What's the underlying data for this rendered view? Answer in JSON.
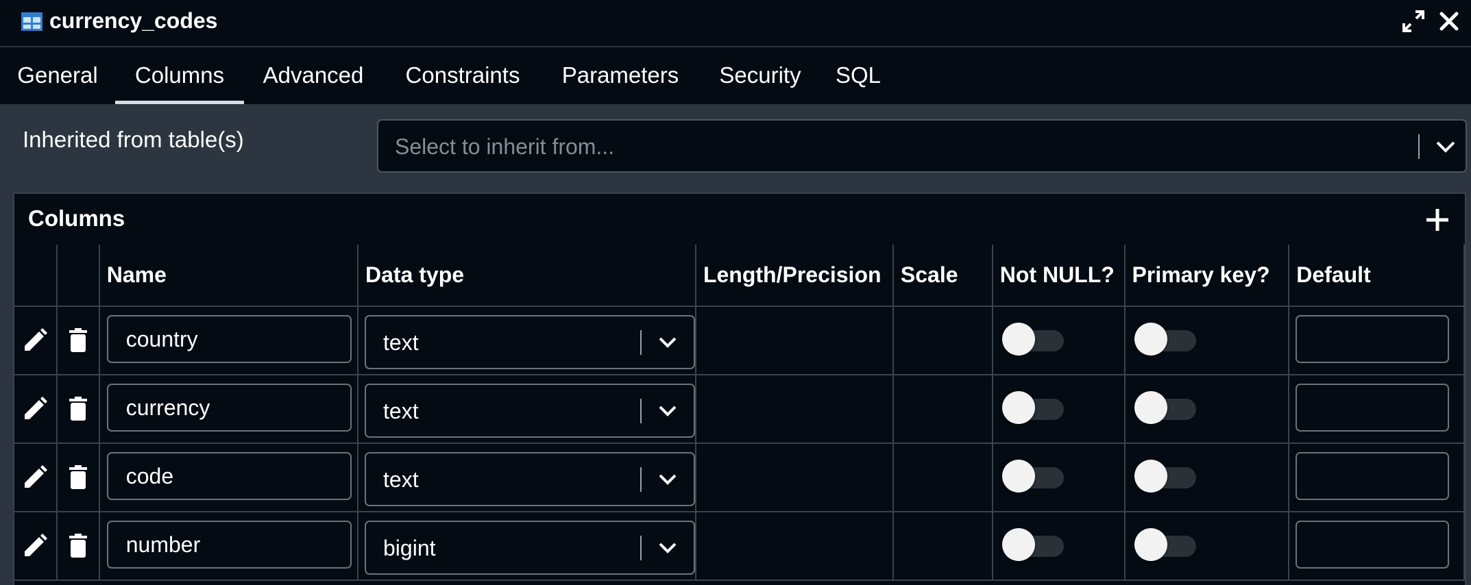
{
  "window": {
    "title": "currency_codes",
    "title_icon": "table-icon",
    "maximize_icon": "maximize-icon",
    "close_icon": "close-icon"
  },
  "tabs": [
    {
      "label": "General",
      "active": false
    },
    {
      "label": "Columns",
      "active": true
    },
    {
      "label": "Advanced",
      "active": false
    },
    {
      "label": "Constraints",
      "active": false
    },
    {
      "label": "Parameters",
      "active": false
    },
    {
      "label": "Security",
      "active": false
    },
    {
      "label": "SQL",
      "active": false
    }
  ],
  "inherit": {
    "label": "Inherited from table(s)",
    "placeholder": "Select to inherit from..."
  },
  "columns_grid": {
    "title": "Columns",
    "add_icon": "plus-icon",
    "headers": {
      "edit": "",
      "delete": "",
      "name": "Name",
      "data_type": "Data type",
      "length": "Length/Precision",
      "scale": "Scale",
      "not_null": "Not NULL?",
      "primary_key": "Primary key?",
      "default": "Default"
    },
    "rows": [
      {
        "name": "country",
        "data_type": "text",
        "length": "",
        "scale": "",
        "not_null": false,
        "primary_key": false,
        "default": ""
      },
      {
        "name": "currency",
        "data_type": "text",
        "length": "",
        "scale": "",
        "not_null": false,
        "primary_key": false,
        "default": ""
      },
      {
        "name": "code",
        "data_type": "text",
        "length": "",
        "scale": "",
        "not_null": false,
        "primary_key": false,
        "default": ""
      },
      {
        "name": "number",
        "data_type": "bigint",
        "length": "",
        "scale": "",
        "not_null": false,
        "primary_key": false,
        "default": ""
      }
    ]
  },
  "colors": {
    "background": "#040b13",
    "panel": "#2c3540",
    "border": "#3a434e",
    "text": "#ffffff",
    "placeholder": "#878d94"
  }
}
